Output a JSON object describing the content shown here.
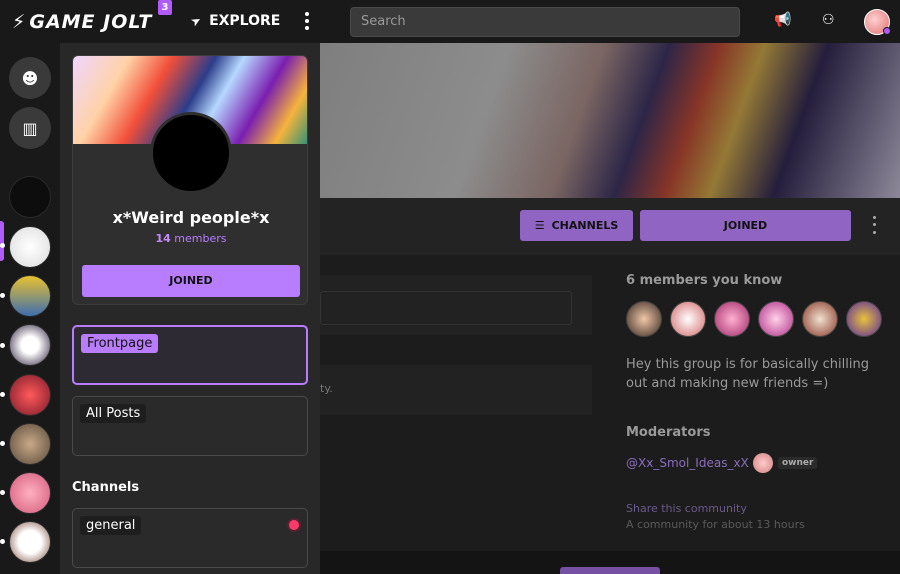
{
  "topbar": {
    "logo_text": "GAME JOLT",
    "notif_count": "3",
    "explore_label": "EXPLORE",
    "search_placeholder": "Search"
  },
  "community_card": {
    "title": "x*Weird people*x",
    "member_count": "14",
    "members_label": "members",
    "joined_label": "JOINED"
  },
  "channels": {
    "frontpage_label": "Frontpage",
    "all_posts_label": "All Posts",
    "section_label": "Channels",
    "general_label": "general"
  },
  "main": {
    "channels_button": "CHANNELS",
    "joined_button": "JOINED",
    "feed_snippet": "ty.",
    "members_you_know": "6 members you know",
    "description": "Hey this group is for basically chilling out and making new friends =)",
    "moderators_title": "Moderators",
    "moderator_name": "@Xx_Smol_Ideas_xX",
    "moderator_role": "owner",
    "share_label": "Share this community",
    "age_label": "A community for about 13 hours"
  },
  "colors": {
    "accent": "#b87dff",
    "background": "#1f1f1f",
    "notification": "#ff3a6a"
  }
}
